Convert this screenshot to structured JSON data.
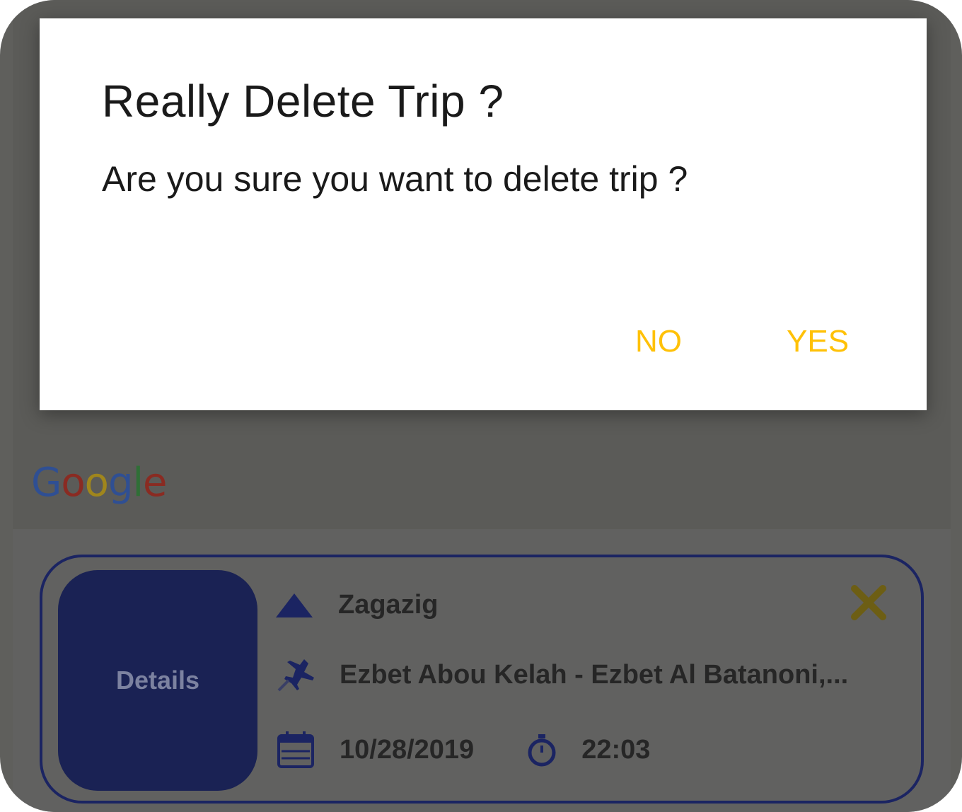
{
  "dialog": {
    "title": "Really Delete Trip ?",
    "message": "Are you sure you want to delete trip ?",
    "no_label": "NO",
    "yes_label": "YES",
    "button_color": "#ffc107"
  },
  "map": {
    "logo_letters": [
      "G",
      "o",
      "o",
      "g",
      "l",
      "e"
    ]
  },
  "trip_card": {
    "details_label": "Details",
    "from_location": "Zagazig",
    "to_location": "Ezbet Abou Kelah - Ezbet Al Batanoni,...",
    "date": "10/28/2019",
    "time": "22:03",
    "accent_color": "#1b2462",
    "icons": {
      "from": "triangle-up-icon",
      "to": "airplane-icon",
      "date": "calendar-icon",
      "time": "stopwatch-icon",
      "delete": "close-icon"
    }
  }
}
